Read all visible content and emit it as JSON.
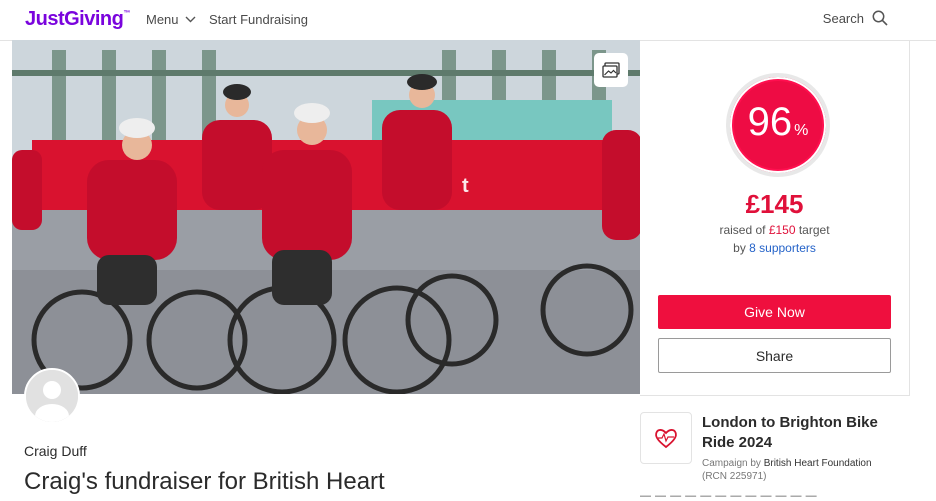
{
  "header": {
    "logo": "JustGiving",
    "logo_tm": "™",
    "menu_label": "Menu",
    "start_fundraising": "Start Fundraising",
    "search_label": "Search"
  },
  "progress": {
    "percent_value": "96",
    "percent_sign": "%",
    "fraction": 0.96,
    "raised": "£145",
    "raised_prefix": "raised of ",
    "target": "£150",
    "target_suffix": " target",
    "by_prefix": "by ",
    "supporters": "8 supporters"
  },
  "actions": {
    "give_now": "Give Now",
    "share": "Share"
  },
  "fundraiser": {
    "owner": "Craig Duff",
    "title": "Craig's fundraiser for British Heart"
  },
  "campaign": {
    "title": "London to Brighton Bike Ride 2024",
    "by_prefix": "Campaign by ",
    "charity": "British Heart Foundation",
    "rcn": "(RCN 225971)"
  },
  "colors": {
    "brand": "#7a04dd",
    "accent": "#ef0f3e",
    "link": "#2563c9"
  }
}
